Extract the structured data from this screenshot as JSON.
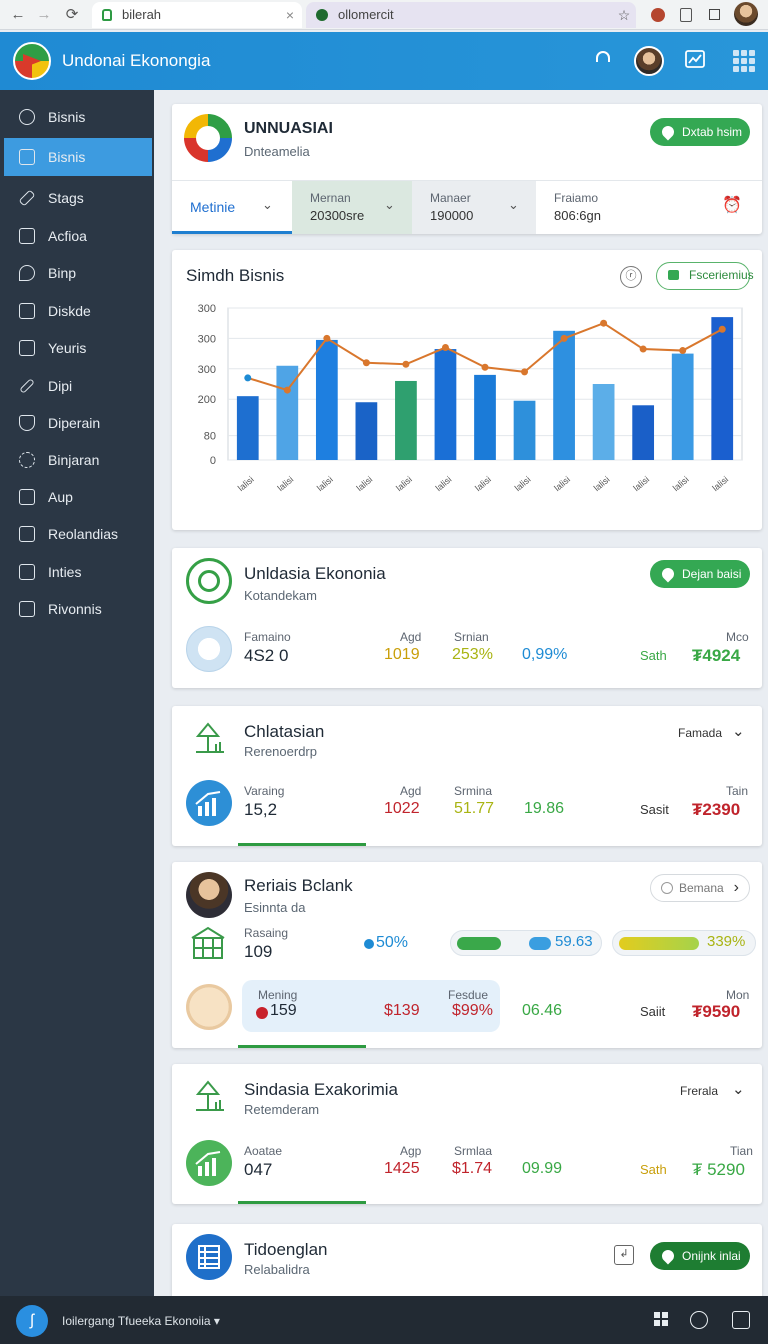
{
  "browser": {
    "tab1_title": "bilerah",
    "tab2_title": "ollomercit",
    "back": "←",
    "forward": "→",
    "reload": "⟳",
    "star": "☆",
    "close": "×"
  },
  "header": {
    "title": "Undonai Ekonongia"
  },
  "sidebar": {
    "items": [
      {
        "label": "Bisnis",
        "icon": "network-icon"
      },
      {
        "label": "Bisnis",
        "icon": "chart-icon"
      },
      {
        "label": "Stags",
        "icon": "pen-icon"
      },
      {
        "label": "Acfioa",
        "icon": "page-icon"
      },
      {
        "label": "Binp",
        "icon": "pin-icon"
      },
      {
        "label": "Diskde",
        "icon": "lock-icon"
      },
      {
        "label": "Yeuris",
        "icon": "list-icon"
      },
      {
        "label": "Dipi",
        "icon": "pencil-icon"
      },
      {
        "label": "Diperain",
        "icon": "shield-icon"
      },
      {
        "label": "Binjaran",
        "icon": "gear-icon"
      },
      {
        "label": "Aup",
        "icon": "box-icon"
      },
      {
        "label": "Reolandias",
        "icon": "table-icon"
      },
      {
        "label": "Inties",
        "icon": "table-icon"
      },
      {
        "label": "Rivonnis",
        "icon": "grid-icon"
      }
    ]
  },
  "card1": {
    "title": "UNNUASIAI",
    "subtitle": "Dnteamelia",
    "badge": "Dxtab hsim",
    "tabs": [
      {
        "label": "Metinie",
        "value": ""
      },
      {
        "label": "Mernan",
        "value": "20300sre"
      },
      {
        "label": "Manaer",
        "value": "190000"
      },
      {
        "label": "Fraiamo",
        "value": "806:6gn"
      }
    ]
  },
  "chart_card": {
    "title": "Simdh Bisnis",
    "badge": "Fsceriemius",
    "icon_glyph": "ⓡ"
  },
  "chart_data": {
    "type": "bar",
    "categories": [
      "lalisi",
      "lalisi",
      "lalisi",
      "lalisi",
      "lalisi",
      "lalisi",
      "lalisi",
      "lalisi",
      "lalisi",
      "lalisi",
      "lalisi",
      "lalisi",
      "lalisi"
    ],
    "yticks": [
      "0",
      "80",
      "200",
      "300",
      "300",
      "300"
    ],
    "ytick_values": [
      0,
      80,
      200,
      300,
      400,
      500
    ],
    "ylim": [
      0,
      500
    ],
    "series": [
      {
        "type": "bar",
        "values": [
          210,
          310,
          395,
          190,
          260,
          365,
          280,
          195,
          425,
          250,
          180,
          350,
          470
        ]
      },
      {
        "type": "line",
        "values": [
          270,
          230,
          400,
          320,
          315,
          370,
          305,
          290,
          400,
          450,
          365,
          360,
          430
        ]
      }
    ],
    "bar_colors": [
      "#1e6fd0",
      "#4fa4e6",
      "#1e7fe0",
      "#1a63c7",
      "#2fa06f",
      "#1a6fd6",
      "#1b7bd8",
      "#2e90db",
      "#2e90e0",
      "#5caee8",
      "#1a5fc8",
      "#3b9ae4",
      "#1a5fcf"
    ],
    "line_color": "#d9772d",
    "grid": true
  },
  "card3": {
    "title": "Unldasia Ekononia",
    "subtitle": "Kotandekam",
    "badge": "Dejan baisi",
    "stats": [
      {
        "label": "Famaino",
        "value": "4S2 0"
      },
      {
        "label": "Agd",
        "value": "1019"
      },
      {
        "label": "Srnian",
        "value": "253%"
      },
      {
        "label": "",
        "value": "0,99%"
      },
      {
        "label": "",
        "value": "Sath"
      },
      {
        "label": "Mco",
        "value": "₮4924"
      }
    ]
  },
  "card4": {
    "title": "Chlatasian",
    "subtitle": "Rerenoerdrp",
    "dropdown": "Famada",
    "stats": [
      {
        "label": "Varaing",
        "value": "15,2"
      },
      {
        "label": "Agd",
        "value": "1022"
      },
      {
        "label": "Srmina",
        "value": "51.77"
      },
      {
        "label": "",
        "value": "19.86"
      },
      {
        "label": "",
        "value": "Sasit"
      },
      {
        "label": "Tain",
        "value": "₮2390"
      }
    ]
  },
  "card5": {
    "title": "Reriais Bclank",
    "subtitle": "Esinnta da",
    "button": "Bemana",
    "row1": {
      "label": "Rasaing",
      "value": "109",
      "pct": "50%",
      "progress1_value": "59.63",
      "progress2_value": "339%"
    },
    "row2": {
      "label1": "Mening",
      "value1": "159",
      "value2": "$139",
      "label3": "Fesdue",
      "value3": "$99%",
      "value4": "06.46",
      "value5": "Saiit",
      "label6": "Mon",
      "value6": "₮9590"
    }
  },
  "card6": {
    "title": "Sindasia Exakorimia",
    "subtitle": "Retemderam",
    "dropdown": "Frerala",
    "stats": [
      {
        "label": "Aoatae",
        "value": "047"
      },
      {
        "label": "Agp",
        "value": "1425"
      },
      {
        "label": "Srmlaa",
        "value": "$1.74"
      },
      {
        "label": "",
        "value": "09.99"
      },
      {
        "label": "",
        "value": "Sath"
      },
      {
        "label": "Tian",
        "value": "₮ 5290"
      }
    ]
  },
  "card7": {
    "title": "Tidoenglan",
    "subtitle": "Relabalidra",
    "button": "Onijnk inlai"
  },
  "bottom": {
    "text": "Ioilergang Tfueeka Ekonoiia ▾",
    "logo_glyph": "ʃ"
  }
}
